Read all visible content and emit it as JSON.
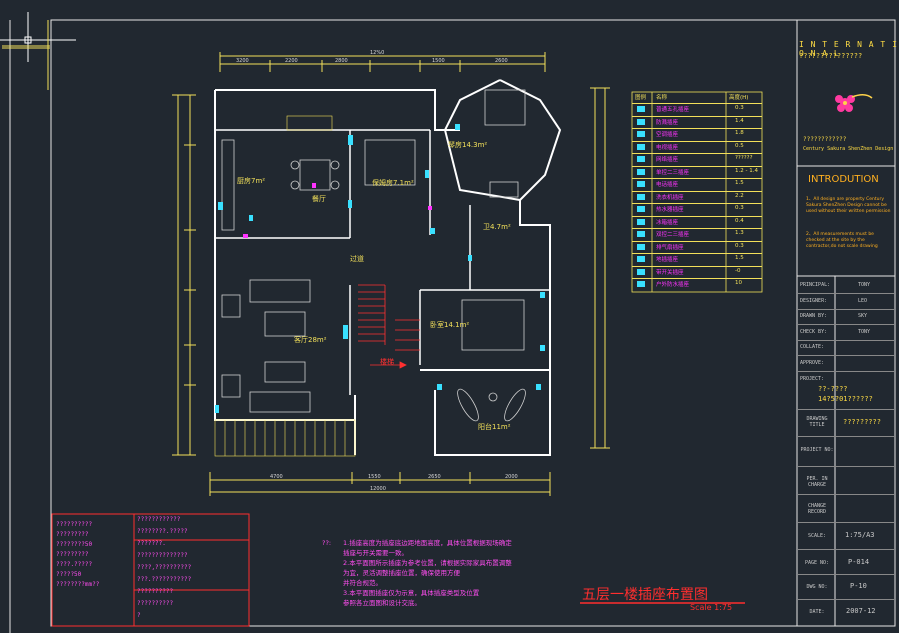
{
  "title_block": {
    "company_heading": "I N T E R N A T I O N A L",
    "company_cn": "???????????????",
    "company_cn2": "????????????",
    "company_en": "Century Sakura ShenZhen Design",
    "intro_title": "INTRODUTION",
    "intro_1": "1、All design are property Century Sakura ShenZhen Design cannot be used without their written  permission",
    "intro_2": "2、All measurements must be checked at the site by the contractor,do not scale drawing",
    "rows": [
      {
        "label": "PRINCIPAL:",
        "value": "TONY"
      },
      {
        "label": "DESIGNER:",
        "value": "LEO"
      },
      {
        "label": "DRAWN BY:",
        "value": "SKY"
      },
      {
        "label": "CHECK BY:",
        "value": "TONY"
      },
      {
        "label": "COLLATE:",
        "value": ""
      },
      {
        "label": "APPROVE:",
        "value": ""
      }
    ],
    "project_label": "PROJECT:",
    "project_value_1": "??-????",
    "project_value_2": "14?5?01??????",
    "drawing_title_label": "DRAWING TITLE",
    "drawing_title_value": "?????????",
    "project_no_label": "PROJECT NO:",
    "per_in_charge_label": "PER. IN CHARGE",
    "change_record_label": "CHANGE RECORD",
    "scale_label": "SCALE:",
    "scale_value": "1:75/A3",
    "page_no_label": "PAGE NO:",
    "page_no_value": "P-014",
    "dwg_no_label": "DWG NO:",
    "dwg_no_value": "P-10",
    "date_label": "DATE:",
    "date_value": "2007-12"
  },
  "drawing": {
    "sheet_title": "五层一楼插座布置图",
    "sheet_scale": "Scale  1:75",
    "rooms": [
      {
        "name": "厨房7m²"
      },
      {
        "name": "餐厅"
      },
      {
        "name": "保姆房7.1m²"
      },
      {
        "name": "琴房14.3m²"
      },
      {
        "name": "卫4.7m²"
      },
      {
        "name": "过道"
      },
      {
        "name": "客厅28m²"
      },
      {
        "name": "楼梯"
      },
      {
        "name": "卧室14.1m²"
      },
      {
        "name": "阳台11m²"
      }
    ],
    "dims_top": [
      "12%0",
      "3200",
      "2200",
      "2800",
      "1500",
      "2600"
    ],
    "dims_bottom": [
      "4700",
      "1550",
      "2650",
      "2000"
    ],
    "dim_total_bottom": "12000"
  },
  "legend": {
    "header": [
      "图例",
      "名称",
      "高度(H)"
    ],
    "rows": [
      {
        "name": "普通五孔插座",
        "height": "0.3"
      },
      {
        "name": "防溅插座",
        "height": "1.4"
      },
      {
        "name": "空调插座",
        "height": "1.8"
      },
      {
        "name": "电视插座",
        "height": "0.5"
      },
      {
        "name": "网络插座",
        "height": "??????"
      },
      {
        "name": "单控二三插座",
        "height": "1.2 - 1.4"
      },
      {
        "name": "电话插座",
        "height": "1.5"
      },
      {
        "name": "洗衣机插座",
        "height": "2.2"
      },
      {
        "name": "热水器插座",
        "height": "0.3"
      },
      {
        "name": "冰箱插座",
        "height": "0.4"
      },
      {
        "name": "双控二三插座",
        "height": "1.3"
      },
      {
        "name": "排气扇插座",
        "height": "0.3"
      },
      {
        "name": "地插插座",
        "height": "1.5"
      },
      {
        "name": "带开关插座",
        "height": "-0"
      },
      {
        "name": "户外防水插座",
        "height": "10"
      }
    ]
  },
  "notes": {
    "prefix": "??:",
    "lines": [
      "1.插座高度为插座底边距地面高度，具体位置根据现场确定",
      "   插座与开关需要一致。",
      "2.本平面图所示插座为参考位置，请根据实际家具布置调整",
      "   为宜，灵活调整插座位置，确保使用方便",
      "   并符合规范。",
      "3.本平面图插座仅为示意，具体插座类型及位置",
      "   参照各立面图和设计交底。"
    ]
  },
  "left_table": {
    "col1": [
      "??????????",
      "?????????",
      "????????50",
      "?????????",
      "????.?????",
      "?????50",
      "????????mm??"
    ],
    "col2": [
      "????????????",
      "????????.?????",
      "???????.",
      "??????????????",
      "????,??????????",
      "???.???????????",
      "??????????",
      "??????????",
      "?"
    ]
  }
}
